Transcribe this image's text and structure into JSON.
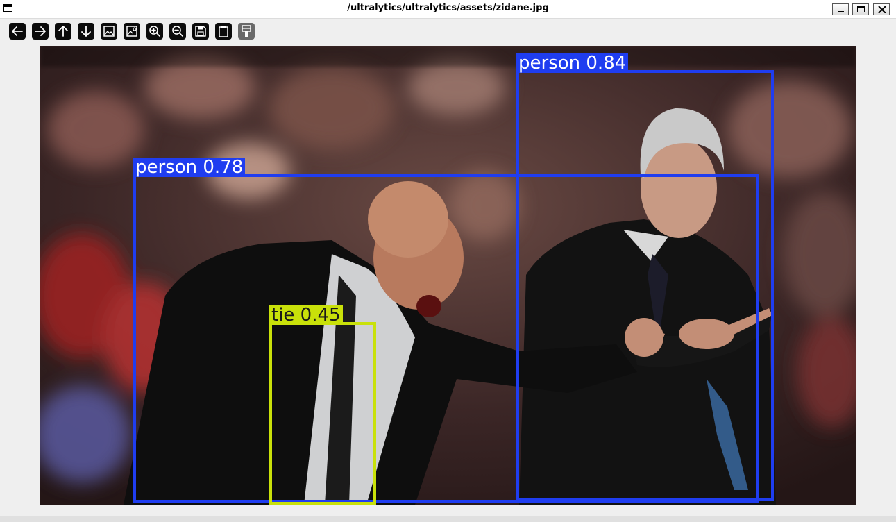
{
  "window": {
    "title": "/ultralytics/ultralytics/assets/zidane.jpg"
  },
  "toolbar": {
    "tools": [
      {
        "name": "back-icon",
        "enabled": true
      },
      {
        "name": "forward-icon",
        "enabled": true
      },
      {
        "name": "up-icon",
        "enabled": true
      },
      {
        "name": "down-icon",
        "enabled": true
      },
      {
        "name": "image-icon",
        "enabled": true
      },
      {
        "name": "image-settings-icon",
        "enabled": true
      },
      {
        "name": "zoom-in-icon",
        "enabled": true
      },
      {
        "name": "zoom-out-icon",
        "enabled": true
      },
      {
        "name": "save-icon",
        "enabled": true
      },
      {
        "name": "clipboard-icon",
        "enabled": true
      },
      {
        "name": "paint-brush-icon",
        "enabled": false
      }
    ]
  },
  "detections": [
    {
      "label": "person 0.84",
      "class": "person",
      "confidence": 0.84,
      "color": "#1f3df0",
      "text_color": "#ffffff"
    },
    {
      "label": "person 0.78",
      "class": "person",
      "confidence": 0.78,
      "color": "#1f3df0",
      "text_color": "#ffffff"
    },
    {
      "label": "tie 0.45",
      "class": "tie",
      "confidence": 0.45,
      "color": "#c9e10a",
      "text_color": "#1a1a1a"
    }
  ],
  "colors": {
    "person_box": "#1f3df0",
    "tie_box": "#c9e10a",
    "toolbar_icon_bg": "#0b0b0b",
    "window_bg": "#efefef"
  }
}
